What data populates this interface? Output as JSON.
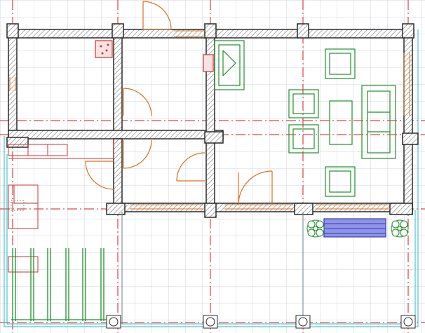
{
  "view": {
    "title": "",
    "grid_visible": true
  },
  "colors": {
    "background": "#ffffff",
    "grid": "#cfd5e0",
    "axis_red": "#d81a1a",
    "wall": "#2a2a2a",
    "wall_hatch": "#8a8a8a",
    "door": "#d9711b",
    "furniture_green": "#1f8f2a",
    "pergola_green": "#1f8f2a",
    "bench_fill": "#8f93e8",
    "bench_stroke": "#3a3ea8",
    "cyan_outline": "#27b8c4",
    "terrace_red": "#cc3333"
  },
  "symbols": {
    "doors": [
      "entry-door",
      "bedroom-door",
      "hall-door",
      "bath-door",
      "lounge-door"
    ],
    "furniture": [
      "sofa",
      "armchair-top",
      "armchair-bottom",
      "coffee-table",
      "chair-1",
      "chair-2",
      "fireplace",
      "stove",
      "pergola",
      "bench",
      "shrub-left",
      "shrub-right",
      "column-bases"
    ]
  }
}
